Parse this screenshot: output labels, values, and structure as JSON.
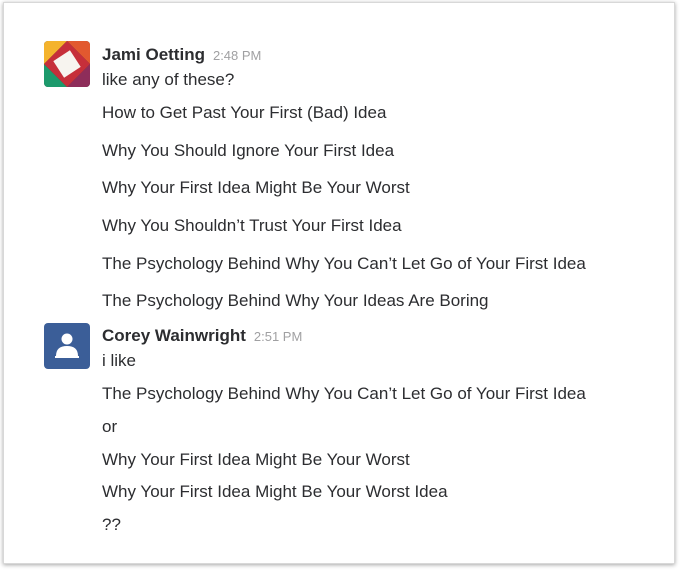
{
  "messages": [
    {
      "author": "Jami Oetting",
      "time": "2:48 PM",
      "avatar_icon": "multicolor-logo-avatar",
      "lines": [
        "like any of these?",
        "How to Get Past Your First (Bad) Idea",
        "Why You Should Ignore Your First Idea",
        "Why Your First Idea Might Be Your Worst",
        "Why You Shouldn’t Trust Your First Idea",
        "The Psychology Behind Why You Can’t Let Go of Your First Idea",
        "The Psychology Behind Why Your Ideas Are Boring"
      ]
    },
    {
      "author": "Corey Wainwright",
      "time": "2:51 PM",
      "avatar_icon": "default-user-avatar",
      "lines": [
        "i like",
        "The Psychology Behind Why You Can’t Let Go of Your First Idea",
        "or",
        "Why Your First Idea Might Be Your Worst",
        "Why Your First Idea Might Be Your Worst Idea",
        "??"
      ]
    }
  ],
  "colors": {
    "text": "#2c2d30",
    "timestamp": "#a0a0a2",
    "corey_avatar_bg": "#3b5e98"
  }
}
